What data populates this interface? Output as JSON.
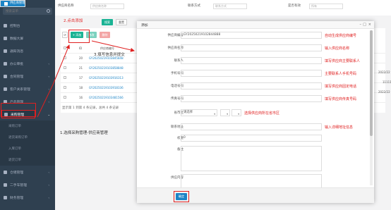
{
  "sidebar": {
    "logo": "合运",
    "search_placeholder": "搜索菜单",
    "items": [
      {
        "label": "控制台",
        "icon": "dashboard-icon"
      },
      {
        "label": "数据大屏",
        "icon": "chart-icon"
      },
      {
        "label": "通知消息",
        "icon": "message-icon"
      },
      {
        "label": "办公审批",
        "icon": "approve-icon"
      },
      {
        "label": "合同管理",
        "icon": "contract-icon"
      },
      {
        "label": "客户关系管理",
        "icon": "customer-icon"
      },
      {
        "label": "产品管理",
        "icon": "product-icon"
      }
    ],
    "active_parent": "采购管理",
    "sub_items": [
      {
        "label": "供应商管理"
      },
      {
        "label": "采购订单"
      },
      {
        "label": "退货采购订单"
      },
      {
        "label": "入库订单"
      },
      {
        "label": "退货订单"
      }
    ],
    "bottom_items": [
      {
        "label": "仓储管理"
      },
      {
        "label": "二手车管理"
      },
      {
        "label": "财务管理"
      }
    ]
  },
  "filters": {
    "label1": "供应商名称",
    "placeholder1": "供应商名称",
    "label2": "联系方式",
    "placeholder2": "联系方式",
    "label3": "是否有效",
    "placeholder3": "所有",
    "search_btn": "搜索",
    "reset_btn": "重置"
  },
  "toolbar": {
    "add_btn": "+ 添加",
    "edit_btn": "修改",
    "delete_btn": "删除"
  },
  "table": {
    "header_id": "ID",
    "header_code": "供应商编号",
    "rows": [
      {
        "id": "20",
        "code": "GY20250219103845848"
      },
      {
        "id": "21",
        "code": "GY20250219103858848"
      },
      {
        "id": "17",
        "code": "GY20250219103916313"
      },
      {
        "id": "18",
        "code": "GY20250219103918336"
      },
      {
        "id": "16",
        "code": "GY20250219103481566"
      }
    ],
    "right_dates": [
      "2022/22",
      "111111",
      "2022/22"
    ],
    "pager": "显示第 1 到第 4 条记录，总共 4 条记录"
  },
  "annotations": {
    "step1": "1.选择采购管理-供应商管理",
    "step2": "2.点击添加",
    "step3": "3.填写信息并提交"
  },
  "modal": {
    "title": "添加",
    "fields": [
      {
        "label": "供应商编号",
        "value": "GY20250219102844888",
        "hint": "自动生成供应商编号"
      },
      {
        "label": "供应商名称",
        "value": "",
        "hint": "输入供应商名称"
      },
      {
        "label": "联系人",
        "value": "",
        "hint": "填写供应商主要联系人"
      },
      {
        "label": "手机号码",
        "value": "",
        "hint": "主要联系人手机号码"
      },
      {
        "label": "电话号码",
        "value": "",
        "hint": "填写供应商固定电话"
      },
      {
        "label": "传真号码",
        "value": "",
        "hint": "填写供应商传真号码"
      }
    ],
    "region_label": "省市区",
    "region_province": "请选择",
    "region_hint": "选择供应商所在省市区",
    "address_label": "联系地址",
    "address_hint": "输入详细地址信息",
    "sort_label": "权重",
    "sort_value": "0",
    "remark_label": "备注",
    "content_label": "供应内容",
    "ok_btn": "确定",
    "colors": {
      "accent": "#1c84c6",
      "annotation": "#e02020"
    }
  }
}
